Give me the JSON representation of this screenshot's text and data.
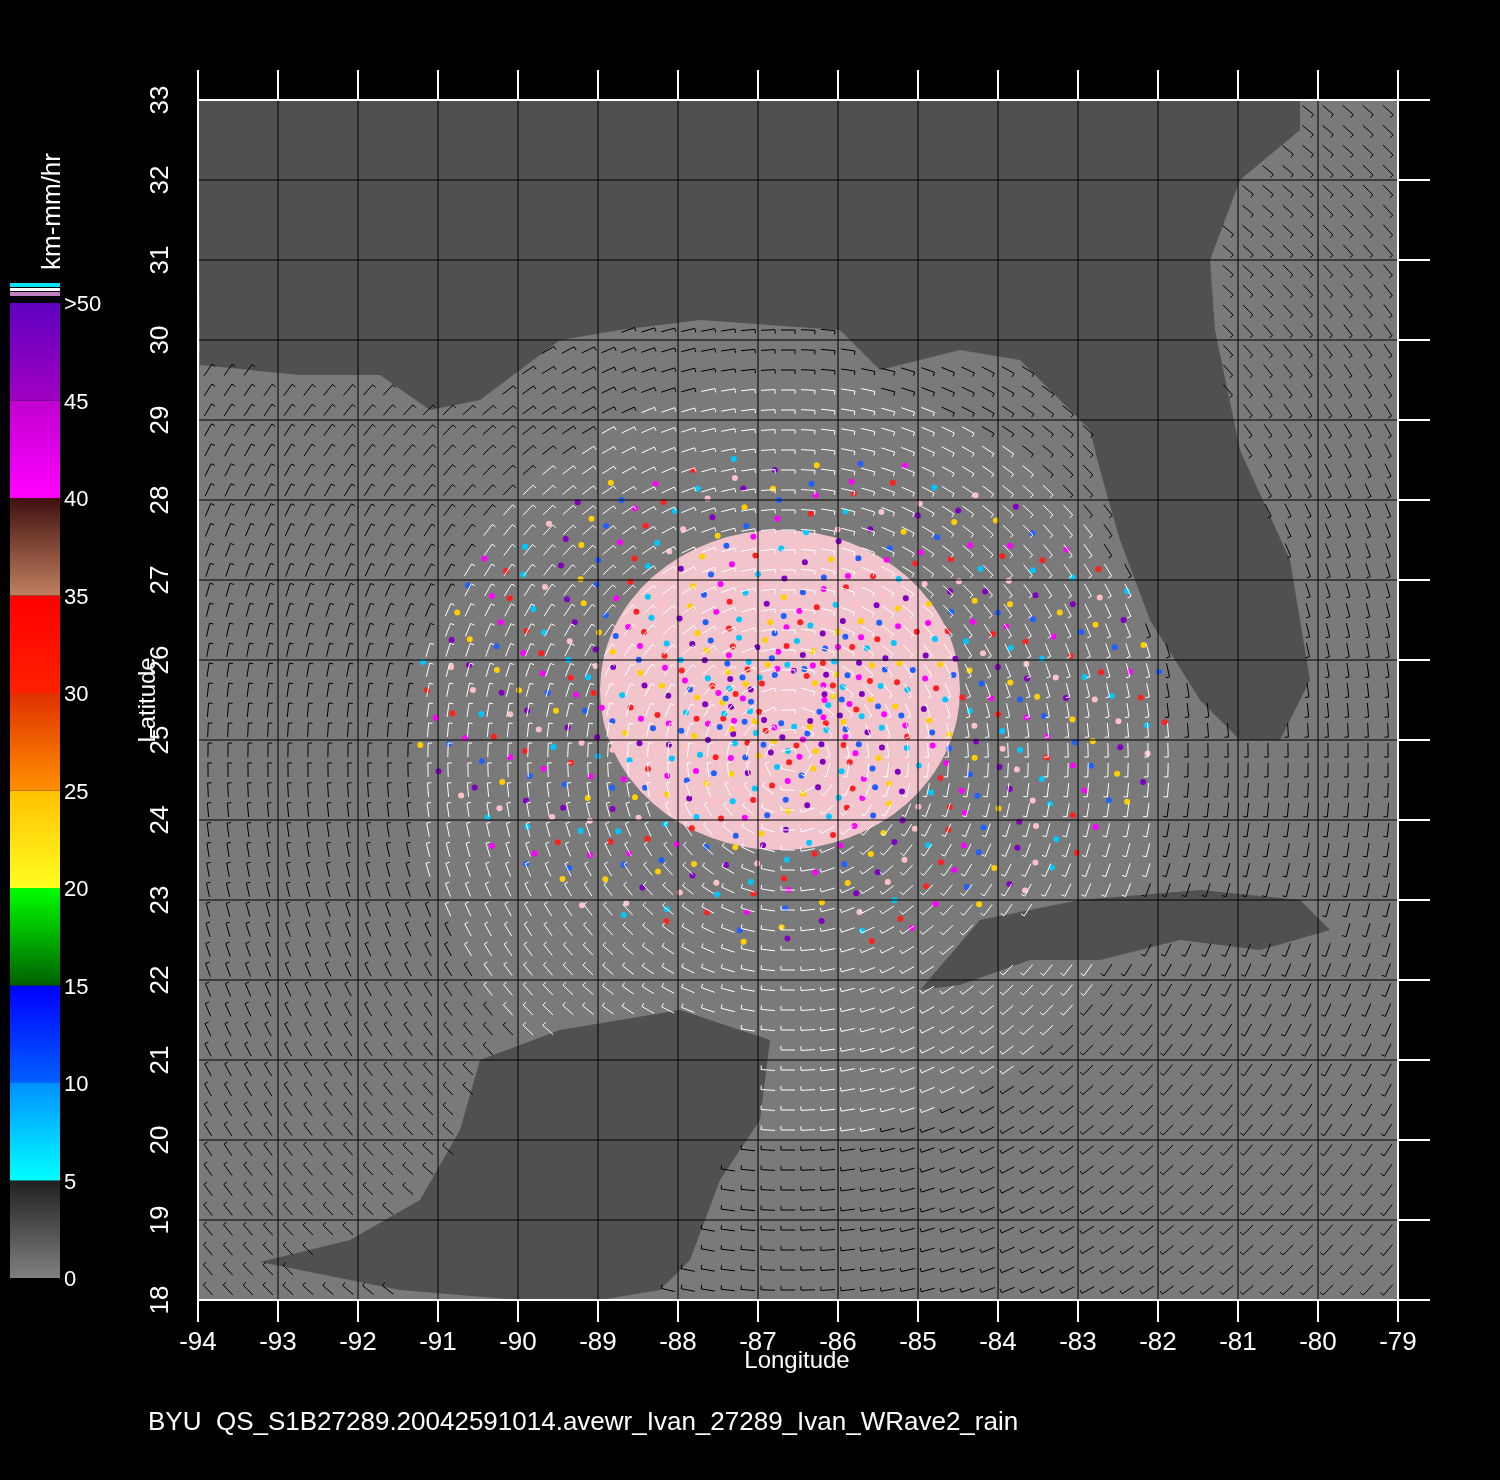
{
  "colorbar": {
    "title": "km-mm/hr",
    "labels": [
      ">50",
      "45",
      "40",
      "35",
      "30",
      "25",
      "20",
      "15",
      "10",
      "5",
      "0"
    ]
  },
  "plot": {
    "xlabel": "Longitude",
    "ylabel": "Latitude",
    "xticks": [
      "-94",
      "-93",
      "-92",
      "-91",
      "-90",
      "-89",
      "-88",
      "-87",
      "-86",
      "-85",
      "-84",
      "-83",
      "-82",
      "-81",
      "-80",
      "-79"
    ],
    "yticks": [
      "18",
      "19",
      "20",
      "21",
      "22",
      "23",
      "24",
      "25",
      "26",
      "27",
      "28",
      "29",
      "30",
      "31",
      "32",
      "33"
    ]
  },
  "caption": "BYU  QS_S1B27289.20042591014.avewr_Ivan_27289_Ivan_WRave2_rain"
}
